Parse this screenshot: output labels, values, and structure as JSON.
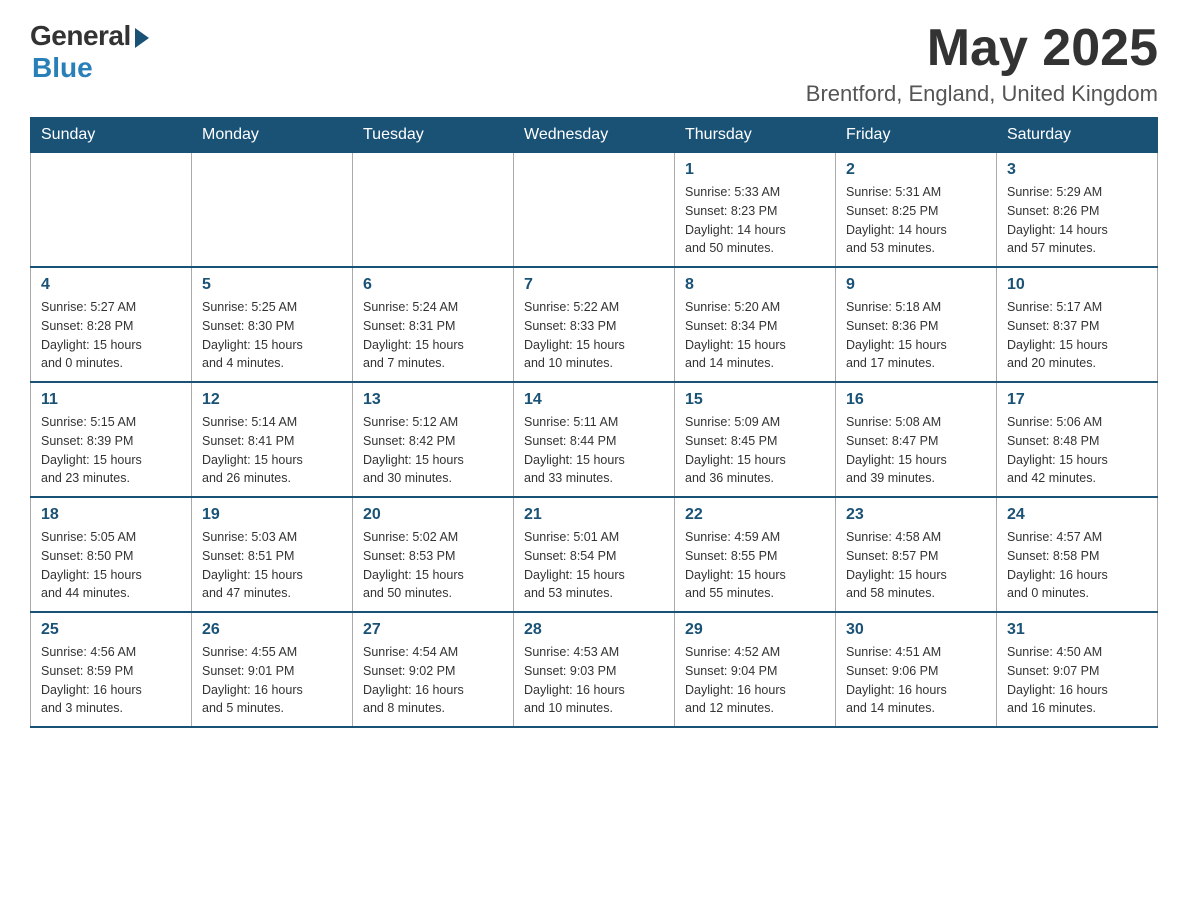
{
  "header": {
    "logo_general": "General",
    "logo_blue": "Blue",
    "month_year": "May 2025",
    "location": "Brentford, England, United Kingdom"
  },
  "days_of_week": [
    "Sunday",
    "Monday",
    "Tuesday",
    "Wednesday",
    "Thursday",
    "Friday",
    "Saturday"
  ],
  "weeks": [
    [
      {
        "day": "",
        "info": ""
      },
      {
        "day": "",
        "info": ""
      },
      {
        "day": "",
        "info": ""
      },
      {
        "day": "",
        "info": ""
      },
      {
        "day": "1",
        "info": "Sunrise: 5:33 AM\nSunset: 8:23 PM\nDaylight: 14 hours\nand 50 minutes."
      },
      {
        "day": "2",
        "info": "Sunrise: 5:31 AM\nSunset: 8:25 PM\nDaylight: 14 hours\nand 53 minutes."
      },
      {
        "day": "3",
        "info": "Sunrise: 5:29 AM\nSunset: 8:26 PM\nDaylight: 14 hours\nand 57 minutes."
      }
    ],
    [
      {
        "day": "4",
        "info": "Sunrise: 5:27 AM\nSunset: 8:28 PM\nDaylight: 15 hours\nand 0 minutes."
      },
      {
        "day": "5",
        "info": "Sunrise: 5:25 AM\nSunset: 8:30 PM\nDaylight: 15 hours\nand 4 minutes."
      },
      {
        "day": "6",
        "info": "Sunrise: 5:24 AM\nSunset: 8:31 PM\nDaylight: 15 hours\nand 7 minutes."
      },
      {
        "day": "7",
        "info": "Sunrise: 5:22 AM\nSunset: 8:33 PM\nDaylight: 15 hours\nand 10 minutes."
      },
      {
        "day": "8",
        "info": "Sunrise: 5:20 AM\nSunset: 8:34 PM\nDaylight: 15 hours\nand 14 minutes."
      },
      {
        "day": "9",
        "info": "Sunrise: 5:18 AM\nSunset: 8:36 PM\nDaylight: 15 hours\nand 17 minutes."
      },
      {
        "day": "10",
        "info": "Sunrise: 5:17 AM\nSunset: 8:37 PM\nDaylight: 15 hours\nand 20 minutes."
      }
    ],
    [
      {
        "day": "11",
        "info": "Sunrise: 5:15 AM\nSunset: 8:39 PM\nDaylight: 15 hours\nand 23 minutes."
      },
      {
        "day": "12",
        "info": "Sunrise: 5:14 AM\nSunset: 8:41 PM\nDaylight: 15 hours\nand 26 minutes."
      },
      {
        "day": "13",
        "info": "Sunrise: 5:12 AM\nSunset: 8:42 PM\nDaylight: 15 hours\nand 30 minutes."
      },
      {
        "day": "14",
        "info": "Sunrise: 5:11 AM\nSunset: 8:44 PM\nDaylight: 15 hours\nand 33 minutes."
      },
      {
        "day": "15",
        "info": "Sunrise: 5:09 AM\nSunset: 8:45 PM\nDaylight: 15 hours\nand 36 minutes."
      },
      {
        "day": "16",
        "info": "Sunrise: 5:08 AM\nSunset: 8:47 PM\nDaylight: 15 hours\nand 39 minutes."
      },
      {
        "day": "17",
        "info": "Sunrise: 5:06 AM\nSunset: 8:48 PM\nDaylight: 15 hours\nand 42 minutes."
      }
    ],
    [
      {
        "day": "18",
        "info": "Sunrise: 5:05 AM\nSunset: 8:50 PM\nDaylight: 15 hours\nand 44 minutes."
      },
      {
        "day": "19",
        "info": "Sunrise: 5:03 AM\nSunset: 8:51 PM\nDaylight: 15 hours\nand 47 minutes."
      },
      {
        "day": "20",
        "info": "Sunrise: 5:02 AM\nSunset: 8:53 PM\nDaylight: 15 hours\nand 50 minutes."
      },
      {
        "day": "21",
        "info": "Sunrise: 5:01 AM\nSunset: 8:54 PM\nDaylight: 15 hours\nand 53 minutes."
      },
      {
        "day": "22",
        "info": "Sunrise: 4:59 AM\nSunset: 8:55 PM\nDaylight: 15 hours\nand 55 minutes."
      },
      {
        "day": "23",
        "info": "Sunrise: 4:58 AM\nSunset: 8:57 PM\nDaylight: 15 hours\nand 58 minutes."
      },
      {
        "day": "24",
        "info": "Sunrise: 4:57 AM\nSunset: 8:58 PM\nDaylight: 16 hours\nand 0 minutes."
      }
    ],
    [
      {
        "day": "25",
        "info": "Sunrise: 4:56 AM\nSunset: 8:59 PM\nDaylight: 16 hours\nand 3 minutes."
      },
      {
        "day": "26",
        "info": "Sunrise: 4:55 AM\nSunset: 9:01 PM\nDaylight: 16 hours\nand 5 minutes."
      },
      {
        "day": "27",
        "info": "Sunrise: 4:54 AM\nSunset: 9:02 PM\nDaylight: 16 hours\nand 8 minutes."
      },
      {
        "day": "28",
        "info": "Sunrise: 4:53 AM\nSunset: 9:03 PM\nDaylight: 16 hours\nand 10 minutes."
      },
      {
        "day": "29",
        "info": "Sunrise: 4:52 AM\nSunset: 9:04 PM\nDaylight: 16 hours\nand 12 minutes."
      },
      {
        "day": "30",
        "info": "Sunrise: 4:51 AM\nSunset: 9:06 PM\nDaylight: 16 hours\nand 14 minutes."
      },
      {
        "day": "31",
        "info": "Sunrise: 4:50 AM\nSunset: 9:07 PM\nDaylight: 16 hours\nand 16 minutes."
      }
    ]
  ]
}
